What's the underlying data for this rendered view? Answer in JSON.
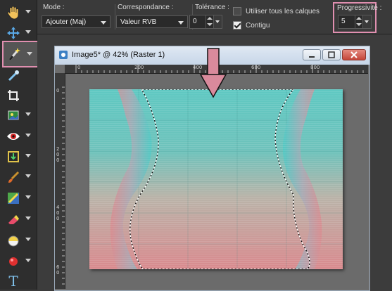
{
  "toolbar": {
    "tools": [
      {
        "name": "pan-tool",
        "icon": "hand-icon"
      },
      {
        "name": "move-tool",
        "icon": "move-arrows-icon"
      },
      {
        "name": "magic-wand-tool",
        "icon": "magic-wand-icon",
        "active": true
      },
      {
        "name": "dropper-tool",
        "icon": "eyedropper-icon"
      },
      {
        "name": "crop-tool",
        "icon": "crop-icon"
      },
      {
        "name": "straighten-tool",
        "icon": "picture-tube-icon"
      },
      {
        "name": "red-eye-tool",
        "icon": "eye-icon"
      },
      {
        "name": "clone-tool",
        "icon": "clone-icon"
      },
      {
        "name": "brush-tool",
        "icon": "paint-brush-icon"
      },
      {
        "name": "retouch-tool",
        "icon": "retouch-icon"
      },
      {
        "name": "eraser-tool",
        "icon": "eraser-icon"
      },
      {
        "name": "fill-tool",
        "icon": "fill-bucket-icon"
      },
      {
        "name": "pen-tool",
        "icon": "pen-icon"
      },
      {
        "name": "text-tool",
        "icon": "text-icon",
        "glyph": "T"
      }
    ]
  },
  "options": {
    "mode": {
      "label": "Mode :",
      "value": "Ajouter (Maj)"
    },
    "match": {
      "label": "Correspondance :",
      "value": "Valeur RVB"
    },
    "tolerance": {
      "label": "Tolérance :",
      "value": "0"
    },
    "all_layers": {
      "label": "Utiliser tous les calques",
      "checked": false
    },
    "contiguous": {
      "label": "Contigu",
      "checked": true
    },
    "feather": {
      "label": "Progressivité :",
      "value": "5"
    }
  },
  "image_window": {
    "title": "Image5* @  42% (Raster 1)",
    "ruler_top": [
      "0",
      "200",
      "400",
      "600",
      "800"
    ],
    "ruler_left": [
      "0",
      "2\n0\n0",
      "4\n0\n0",
      "6\n0"
    ]
  },
  "colors": {
    "highlight": "#e08fb0",
    "arrow": "#d98a9c",
    "teal": "#4ec9c4",
    "pink": "#d98a8e"
  }
}
